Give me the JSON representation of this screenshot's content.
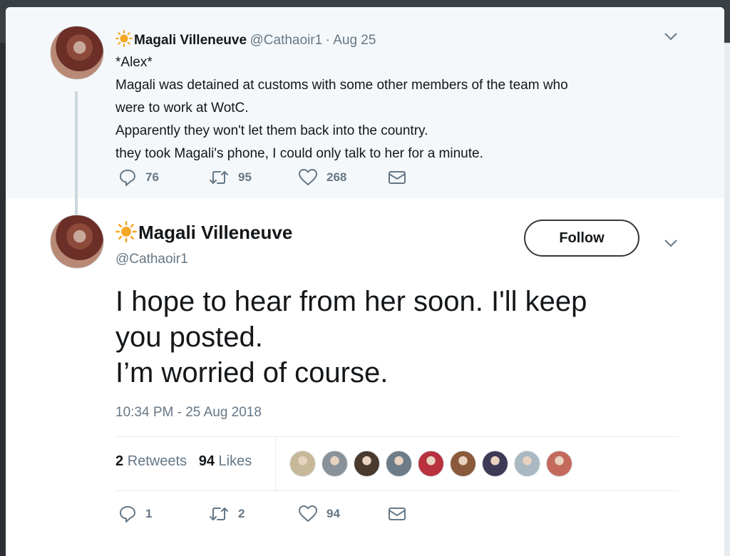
{
  "parent_tweet": {
    "display_name": "Magali Villeneuve",
    "handle": "@Cathaoir1",
    "date": "· Aug 25",
    "lines": [
      "*Alex*",
      "Magali was detained at customs with some other members of the team who",
      "were to work at WotC.",
      "Apparently they won't let them back into the country.",
      "they took Magali's phone, I could only talk to her for a minute."
    ],
    "replies": "76",
    "retweets": "95",
    "likes": "268"
  },
  "main_tweet": {
    "display_name": "Magali Villeneuve",
    "handle": "@Cathaoir1",
    "follow_label": "Follow",
    "lines": [
      "I hope to hear from her soon. I'll keep",
      "you posted.",
      "I’m worried of course."
    ],
    "timestamp": "10:34 PM - 25 Aug 2018",
    "retweet_count": "2",
    "retweet_label": "Retweets",
    "like_count": "94",
    "like_label": "Likes",
    "replies": "1",
    "retweets": "2",
    "likes": "94"
  },
  "liker_colors": [
    "#c8b89a",
    "#8a9299",
    "#4a3a2e",
    "#6d7c86",
    "#b7323e",
    "#8a5a3a",
    "#3d3a55",
    "#aab8c2",
    "#c46a5c"
  ],
  "colors": {
    "gray_text": "#657786",
    "accent_sun": "#f5a623",
    "icon_gray": "#657786"
  }
}
